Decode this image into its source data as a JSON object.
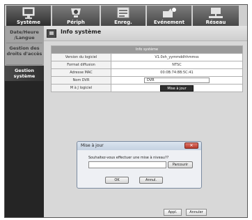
{
  "nav": {
    "tabs": [
      {
        "label": "Système",
        "icon": "monitor-icon"
      },
      {
        "label": "Périph",
        "icon": "camera-icon"
      },
      {
        "label": "Enreg.",
        "icon": "recording-icon"
      },
      {
        "label": "Evénement",
        "icon": "event-icon"
      },
      {
        "label": "Réseau",
        "icon": "network-icon"
      }
    ],
    "active_tab": "Système"
  },
  "sidebar": {
    "items": [
      {
        "label": "Date/Heure /Langue"
      },
      {
        "label": "Gestion des droits d'accès"
      },
      {
        "label": "Gestion système"
      }
    ],
    "active_item": "Gestion système"
  },
  "page": {
    "title": "Info système"
  },
  "info_table": {
    "header": "Info système",
    "rows": [
      {
        "label": "Version du logiciel",
        "value": "V1.0xh_yymmddhhmmss"
      },
      {
        "label": "Format diffusion",
        "value": "NTSC"
      },
      {
        "label": "Adresse MAC",
        "value": "00:0B:74:8B:5C:41"
      },
      {
        "label": "Nom DVR",
        "value": "DVR"
      },
      {
        "label": "M à J logiciel",
        "value": "Mise à jour"
      }
    ]
  },
  "dialog": {
    "title": "Mise à jour",
    "question": "Souhaitez-vous effectuer une mise à niveau??",
    "browse_label": "Parcourir",
    "ok_label": "OK",
    "cancel_label": "Annul.",
    "file_value": ""
  },
  "footer": {
    "apply_label": "Appl.",
    "cancel_label": "Annuler"
  },
  "colors": {
    "active_tab": "#2e2e2e",
    "sidebar_active": "#303030",
    "table_header": "#9a9a9a"
  }
}
